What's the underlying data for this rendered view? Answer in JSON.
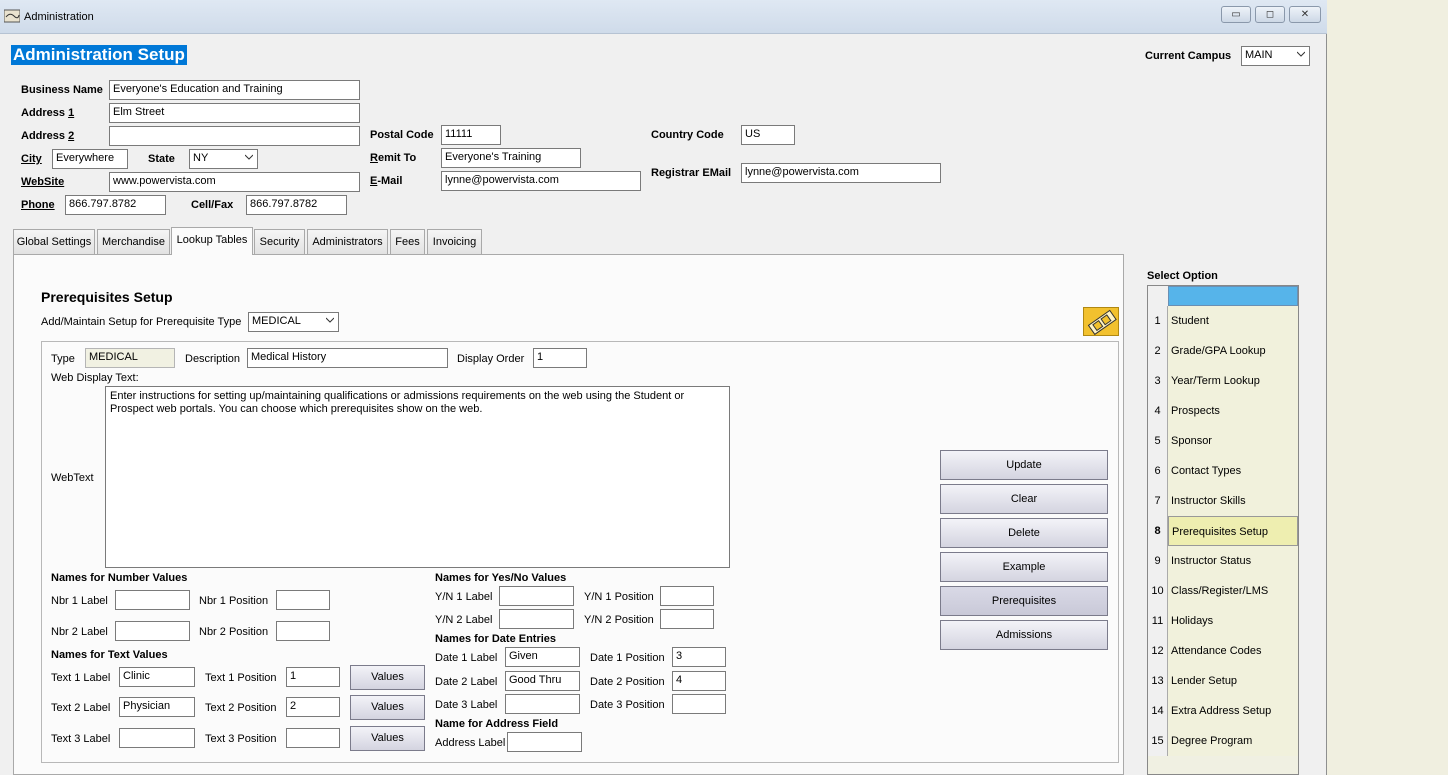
{
  "window": {
    "title": "Administration",
    "controls": {
      "minimize": "▭",
      "restore": "◻",
      "close": "✕"
    }
  },
  "page_title": "Administration Setup",
  "campus": {
    "label": "Current Campus",
    "value": "MAIN"
  },
  "business": {
    "business_name_label": "Business Name",
    "business_name": "Everyone's Education and Training",
    "address1_label": "Address 1",
    "address1": "Elm Street",
    "address2_label": "Address 2",
    "address2": "",
    "city_label": "City",
    "city": "Everywhere",
    "state_label": "State",
    "state": "NY",
    "website_label": "WebSite",
    "website": "www.powervista.com",
    "phone_label": "Phone",
    "phone": "866.797.8782",
    "cellfax_label": "Cell/Fax",
    "cellfax": "866.797.8782",
    "postal_label": "Postal Code",
    "postal": "11111",
    "remit_label": "Remit To",
    "remit": "Everyone's Training",
    "email_label": "E-Mail",
    "email": "lynne@powervista.com",
    "country_label": "Country Code",
    "country": "US",
    "registrar_label": "Registrar EMail",
    "registrar": "lynne@powervista.com"
  },
  "tabs": [
    "Global Settings",
    "Merchandise",
    "Lookup Tables",
    "Security",
    "Administrators",
    "Fees",
    "Invoicing"
  ],
  "active_tab": "Lookup Tables",
  "prereq": {
    "heading": "Prerequisites Setup",
    "type_select_label": "Add/Maintain Setup for Prerequisite Type",
    "type_select_value": "MEDICAL",
    "type_label": "Type",
    "type_value": "MEDICAL",
    "desc_label": "Description",
    "desc_value": "Medical History",
    "order_label": "Display Order",
    "order_value": "1",
    "web_display_label": "Web Display Text:",
    "webtext_label": "WebText",
    "webtext": "Enter instructions for setting up/maintaining qualifications or admissions requirements on the web using the Student or Prospect web portals. You can choose which prerequisites show on the web."
  },
  "numbers": {
    "heading": "Names for Number Values",
    "nbr1_label": "Nbr 1 Label",
    "nbr1_value": "",
    "nbr1_pos_label": "Nbr 1 Position",
    "nbr1_pos": "",
    "nbr2_label": "Nbr 2 Label",
    "nbr2_value": "",
    "nbr2_pos_label": "Nbr 2 Position",
    "nbr2_pos": ""
  },
  "texts": {
    "heading": "Names for Text Values",
    "rows": [
      {
        "label": "Text 1 Label",
        "value": "Clinic",
        "pos_label": "Text 1 Position",
        "pos": "1",
        "button": "Values"
      },
      {
        "label": "Text 2 Label",
        "value": "Physician",
        "pos_label": "Text 2 Position",
        "pos": "2",
        "button": "Values"
      },
      {
        "label": "Text 3 Label",
        "value": "",
        "pos_label": "Text 3 Position",
        "pos": "",
        "button": "Values"
      }
    ]
  },
  "yesno": {
    "heading": "Names for Yes/No Values",
    "yn1_label": "Y/N 1 Label",
    "yn1_value": "",
    "yn1_pos_label": "Y/N 1 Position",
    "yn1_pos": "",
    "yn2_label": "Y/N 2 Label",
    "yn2_value": "",
    "yn2_pos_label": "Y/N 2 Position",
    "yn2_pos": ""
  },
  "dates": {
    "heading": "Names for Date Entries",
    "rows": [
      {
        "label": "Date 1 Label",
        "value": "Given",
        "pos_label": "Date 1 Position",
        "pos": "3"
      },
      {
        "label": "Date 2 Label",
        "value": "Good Thru",
        "pos_label": "Date 2 Position",
        "pos": "4"
      },
      {
        "label": "Date 3 Label",
        "value": "",
        "pos_label": "Date 3 Position",
        "pos": ""
      }
    ]
  },
  "address_field": {
    "heading": "Name for Address Field",
    "label": "Address Label",
    "value": ""
  },
  "actions": [
    "Update",
    "Clear",
    "Delete",
    "Example",
    "Prerequisites",
    "Admissions"
  ],
  "select_option": {
    "heading": "Select Option",
    "items": [
      {
        "num": "1",
        "label": "Student"
      },
      {
        "num": "2",
        "label": "Grade/GPA Lookup"
      },
      {
        "num": "3",
        "label": "Year/Term Lookup"
      },
      {
        "num": "4",
        "label": "Prospects"
      },
      {
        "num": "5",
        "label": "Sponsor"
      },
      {
        "num": "6",
        "label": "Contact Types"
      },
      {
        "num": "7",
        "label": "Instructor Skills"
      },
      {
        "num": "8",
        "label": "Prerequisites Setup"
      },
      {
        "num": "9",
        "label": "Instructor Status"
      },
      {
        "num": "10",
        "label": "Class/Register/LMS"
      },
      {
        "num": "11",
        "label": "Holidays"
      },
      {
        "num": "12",
        "label": "Attendance Codes"
      },
      {
        "num": "13",
        "label": "Lender Setup"
      },
      {
        "num": "14",
        "label": "Extra Address Setup"
      },
      {
        "num": "15",
        "label": "Degree Program"
      }
    ],
    "selected": "8"
  },
  "colors": {
    "title_highlight": "#0078d7",
    "grid_header": "#56b4ea",
    "grid_row": "#f1f1dc",
    "grid_selected": "#eeeeb0"
  }
}
